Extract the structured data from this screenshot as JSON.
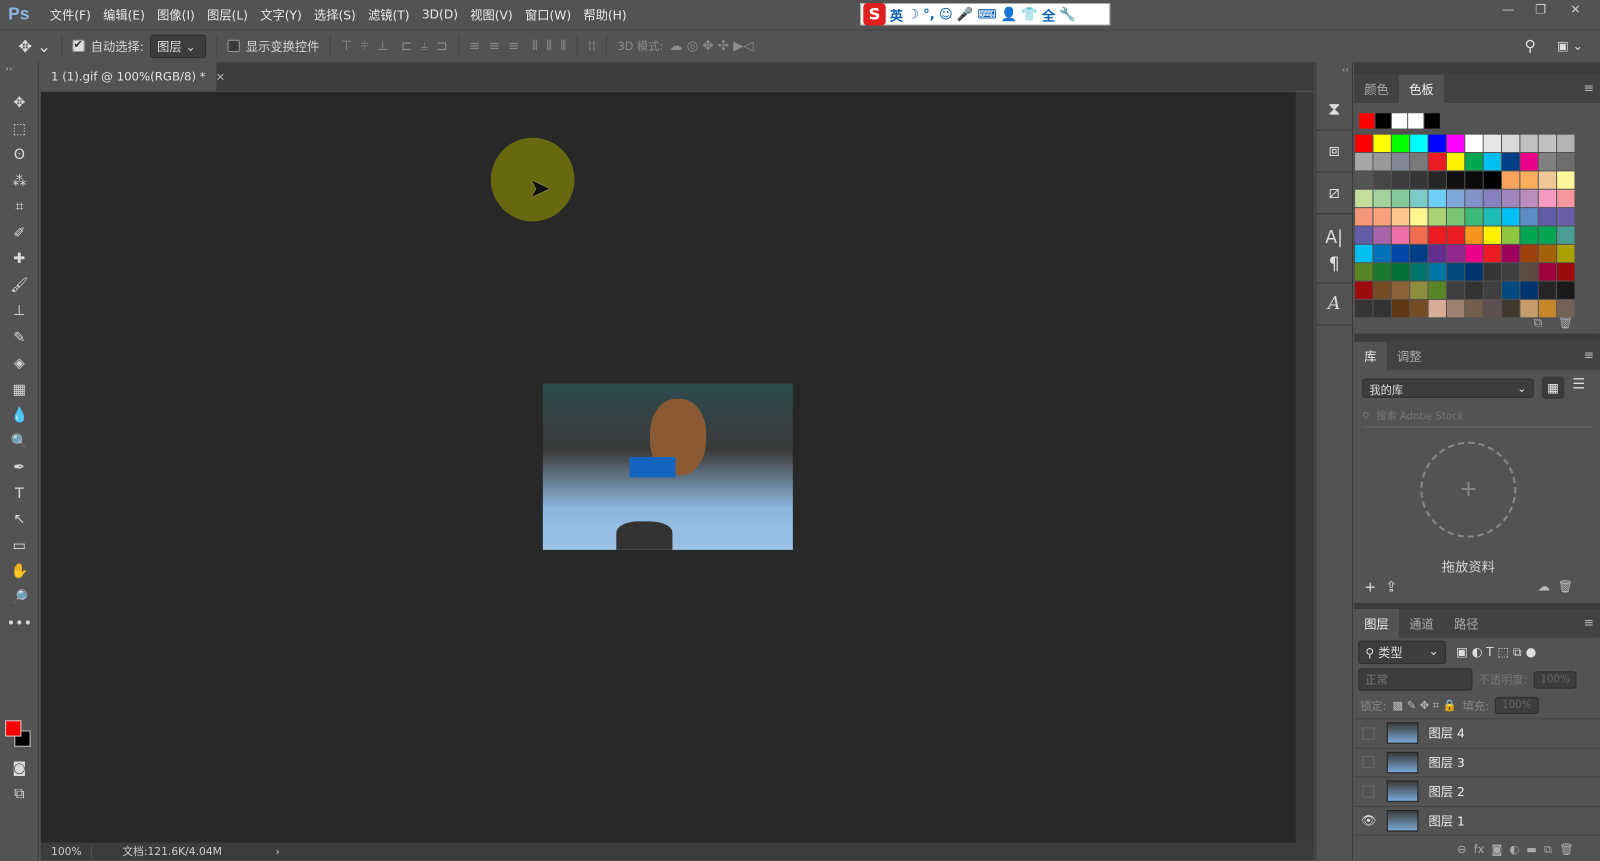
{
  "app": {
    "logo": "Ps"
  },
  "menu": [
    "文件(F)",
    "编辑(E)",
    "图像(I)",
    "图层(L)",
    "文字(Y)",
    "选择(S)",
    "滤镜(T)",
    "3D(D)",
    "视图(V)",
    "窗口(W)",
    "帮助(H)"
  ],
  "ime": {
    "logo": "S",
    "items": [
      "英",
      "☽",
      "°,",
      "☺",
      "🎤",
      "⌨",
      "👤",
      "👕",
      "全",
      "🔧"
    ]
  },
  "window": {
    "minimize": "—",
    "restore": "❐",
    "close": "✕"
  },
  "options": {
    "auto_select_label": "自动选择:",
    "auto_select_checked": true,
    "auto_select_value": "图层",
    "show_transform_label": "显示变换控件",
    "show_transform_checked": false,
    "mode_3d_label": "3D 模式:"
  },
  "document": {
    "tab_title": "1 (1).gif @ 100%(RGB/8) *",
    "close": "×"
  },
  "status": {
    "zoom": "100%",
    "doc_info": "文档:121.6K/4.04M",
    "arrow": "›"
  },
  "tools": [
    "✥",
    "⬚",
    "ʘ",
    "⁂",
    "⌗",
    "✐",
    "✚",
    "🖌",
    "⊥",
    "✎",
    "◈",
    "▦",
    "💧",
    "🔍",
    "✒",
    "T",
    "↖",
    "▭",
    "✋",
    "🔎",
    "•••"
  ],
  "colors": {
    "foreground": "#ff0000",
    "background": "#000000"
  },
  "swatch_panel": {
    "tabs": [
      "颜色",
      "色板"
    ],
    "active": 1,
    "recent": [
      "#ff0000",
      "#000000",
      "#ffffff",
      "#ffffff",
      "#000000"
    ],
    "swatches": [
      [
        "#ff0000",
        "#ffff00",
        "#00ff00",
        "#00ffff",
        "#0000ff",
        "#ff00ff",
        "#ffffff",
        "#e6e6e6",
        "#d9d9d9",
        "#c0c0c0",
        "#c0c0c0",
        "#b3b3b3"
      ],
      [
        "#a6a6a6",
        "#999999",
        "#7f8894",
        "#7a7a7a",
        "#ed1c24",
        "#fff200",
        "#00a651",
        "#00bff3",
        "#003f87",
        "#ec008c",
        "#808080",
        "#6e6e6e"
      ],
      [
        "#555555",
        "#464646",
        "#3c3c3c",
        "#363636",
        "#262626",
        "#111111",
        "#0a0a0a",
        "#000000",
        "#f7a35c",
        "#fbaf5d",
        "#f0c896",
        "#fff799"
      ],
      [
        "#c4df9b",
        "#a2d39c",
        "#82ca9c",
        "#7accc8",
        "#6dcff6",
        "#7da7d9",
        "#8393ca",
        "#8781bd",
        "#a186be",
        "#bd8cbf",
        "#f49ac1",
        "#f5989d"
      ],
      [
        "#f7977a",
        "#f9a27a",
        "#fdc68a",
        "#fff68f",
        "#acd373",
        "#7cc576",
        "#3cb878",
        "#1cbbb4",
        "#00bff3",
        "#5d8bc4",
        "#605ca8",
        "#6b5ea8"
      ],
      [
        "#605ca8",
        "#a864a8",
        "#f06eaa",
        "#f26c4f",
        "#ed1c24",
        "#ed1c24",
        "#f7941d",
        "#fff200",
        "#8dc63f",
        "#00a651",
        "#00a651",
        "#4a9d93"
      ],
      [
        "#00bff3",
        "#0072bc",
        "#0047ab",
        "#003f87",
        "#662d91",
        "#92278f",
        "#ec008c",
        "#ed1c24",
        "#9e005d",
        "#a0410d",
        "#a36209",
        "#aba000"
      ],
      [
        "#598527",
        "#1a7b30",
        "#007236",
        "#00746b",
        "#0076a3",
        "#004a80",
        "#003471",
        "#363636",
        "#404040",
        "#5d4a40",
        "#9e0039",
        "#9e0b0f"
      ],
      [
        "#9e0b0f",
        "#754c24",
        "#8c6239",
        "#8c8c3c",
        "#598527",
        "#404040",
        "#333333",
        "#404040",
        "#004a80",
        "#003471",
        "#262626",
        "#1a1a1a"
      ],
      [
        "#363636",
        "#333333",
        "#603913",
        "#754c24",
        "#d9ad95",
        "#a08070",
        "#735e4b",
        "#5e5050",
        "#40392f",
        "#c69c6d",
        "#c7862a",
        "#736357"
      ]
    ]
  },
  "library_panel": {
    "tabs": [
      "库",
      "调整"
    ],
    "active": 0,
    "library": "我的库",
    "search_placeholder": "搜索 Adobe Stock",
    "drop_label": "拖放资料"
  },
  "layers_panel": {
    "tabs": [
      "图层",
      "通道",
      "路径"
    ],
    "active": 0,
    "filter": "类型",
    "blend_mode": "正常",
    "opacity_label": "不透明度:",
    "opacity": "100%",
    "lock_label": "锁定:",
    "fill_label": "填充:",
    "fill": "100%",
    "layers": [
      {
        "name": "图层 4",
        "visible": false
      },
      {
        "name": "图层 3",
        "visible": false
      },
      {
        "name": "图层 2",
        "visible": false
      },
      {
        "name": "图层 1",
        "visible": true
      }
    ]
  }
}
